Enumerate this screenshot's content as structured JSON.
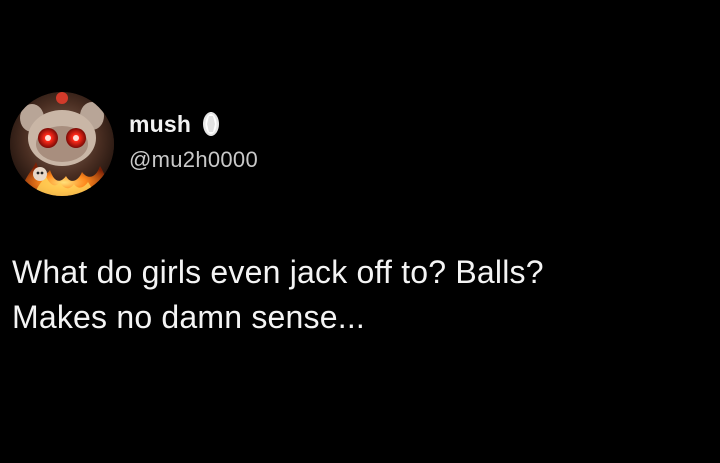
{
  "author": {
    "display_name": "mush",
    "handle": "@mu2h0000",
    "avatar_icon": "avatar-illustration-icon",
    "badge_icon": "verified-badge-icon"
  },
  "tweet": {
    "text": "What do girls even jack off to? Balls?\nMakes no damn sense..."
  },
  "colors": {
    "background": "#000000",
    "name": "#f2f2f2",
    "handle": "#c9c9c9",
    "text": "#f4f4f4"
  }
}
